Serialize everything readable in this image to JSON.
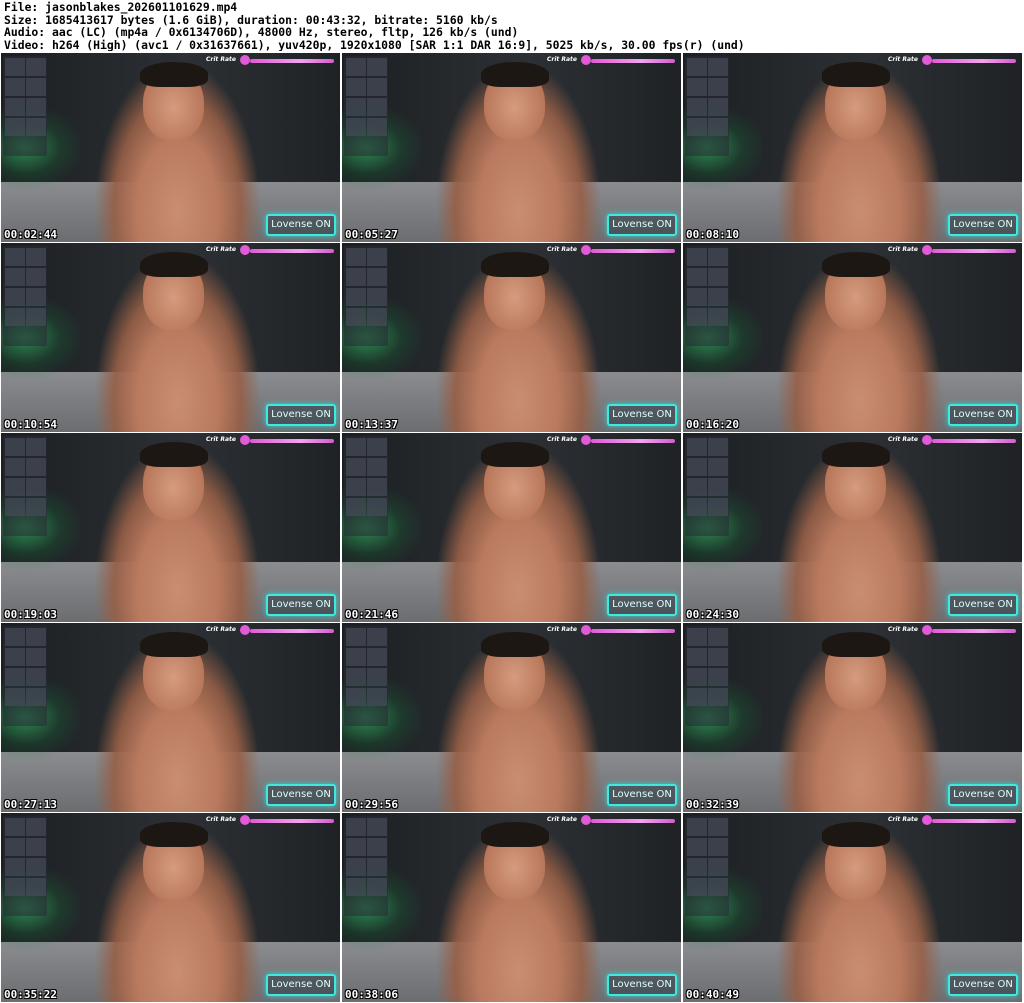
{
  "header": {
    "line1": "File: jasonblakes_202601101629.mp4",
    "line2": "Size: 1685413617 bytes (1.6 GiB), duration: 00:43:32, bitrate: 5160 kb/s",
    "line3": "Audio: aac (LC) (mp4a / 0x6134706D), 48000 Hz, stereo, fltp, 126 kb/s (und)",
    "line4": "Video: h264 (High) (avc1 / 0x31637661), yuv420p, 1920x1080 [SAR 1:1 DAR 16:9], 5025 kb/s, 30.00 fps(r) (und)"
  },
  "overlay": {
    "crit_label": "Crit Rate",
    "lovense_label": "Lovense ON"
  },
  "thumbnails": [
    {
      "timestamp": "00:02:44"
    },
    {
      "timestamp": "00:05:27"
    },
    {
      "timestamp": "00:08:10"
    },
    {
      "timestamp": "00:10:54"
    },
    {
      "timestamp": "00:13:37"
    },
    {
      "timestamp": "00:16:20"
    },
    {
      "timestamp": "00:19:03"
    },
    {
      "timestamp": "00:21:46"
    },
    {
      "timestamp": "00:24:30"
    },
    {
      "timestamp": "00:27:13"
    },
    {
      "timestamp": "00:29:56"
    },
    {
      "timestamp": "00:32:39"
    },
    {
      "timestamp": "00:35:22"
    },
    {
      "timestamp": "00:38:06"
    },
    {
      "timestamp": "00:40:49"
    }
  ]
}
